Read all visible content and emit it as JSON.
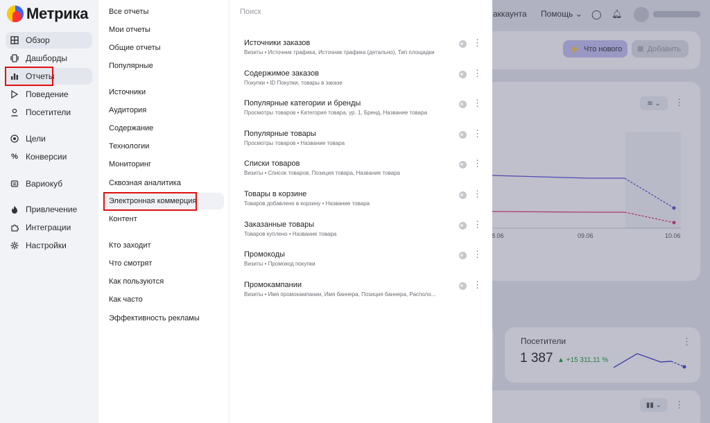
{
  "app": {
    "logo_text": "Метрика",
    "brand_colors": [
      "#ffcc00",
      "#3a66ff",
      "#ff3333"
    ]
  },
  "rail": {
    "items": [
      {
        "label": "Обзор",
        "icon": "grid-icon"
      },
      {
        "label": "Дашборды",
        "icon": "dashboard-icon"
      },
      {
        "label": "Отчеты",
        "icon": "bar-chart-icon"
      },
      {
        "label": "Поведение",
        "icon": "play-icon"
      },
      {
        "label": "Посетители",
        "icon": "person-icon"
      },
      {
        "label": "Цели",
        "icon": "target-icon"
      },
      {
        "label": "Конверсии",
        "icon": "percent-icon"
      },
      {
        "label": "Вариокуб",
        "icon": "cube-icon"
      },
      {
        "label": "Привлечение",
        "icon": "flame-icon"
      },
      {
        "label": "Интеграции",
        "icon": "puzzle-icon"
      },
      {
        "label": "Настройки",
        "icon": "gear-icon"
      }
    ]
  },
  "categories": {
    "group1": [
      "Все отчеты",
      "Мои отчеты",
      "Общие отчеты",
      "Популярные"
    ],
    "group2": [
      "Источники",
      "Аудитория",
      "Содержание",
      "Технологии",
      "Мониторинг",
      "Сквозная аналитика",
      "Электронная коммерция",
      "Контент"
    ],
    "group3": [
      "Кто заходит",
      "Что смотрят",
      "Как пользуются",
      "Как часто",
      "Эффективность рекламы"
    ]
  },
  "reports": {
    "search_placeholder": "Поиск",
    "items": [
      {
        "title": "Источники заказов",
        "sub": "Визиты • Источник трафика, Источник трафика (детально), Тип площадки"
      },
      {
        "title": "Содержимое заказов",
        "sub": "Покупки • ID Покупки, товары в заказе"
      },
      {
        "title": "Популярные категории и бренды",
        "sub": "Просмотры товаров • Категория товара, ур. 1, Бренд, Название товара"
      },
      {
        "title": "Популярные товары",
        "sub": "Просмотры товаров • Название товара"
      },
      {
        "title": "Списки товаров",
        "sub": "Визиты • Список товаров, Позиция товара, Название товара"
      },
      {
        "title": "Товары в корзине",
        "sub": "Товаров добавлено в корзину • Название товара"
      },
      {
        "title": "Заказанные товары",
        "sub": "Товаров куплено • Название товара"
      },
      {
        "title": "Промокоды",
        "sub": "Визиты • Промокод покупки"
      },
      {
        "title": "Промокампании",
        "sub": "Визиты • Имя промокампании, Имя баннера, Позиция баннера, Располо..."
      }
    ]
  },
  "background": {
    "topbar_account": "аккаунта",
    "topbar_help": "Помощь",
    "whats_new": "Что нового",
    "add": "Добавить",
    "axis_labels": [
      "8.06",
      "09.06",
      "10.06"
    ],
    "kpi": {
      "title": "Посетители",
      "value": "1 387",
      "delta": "▲ +15 311,11 %"
    }
  }
}
